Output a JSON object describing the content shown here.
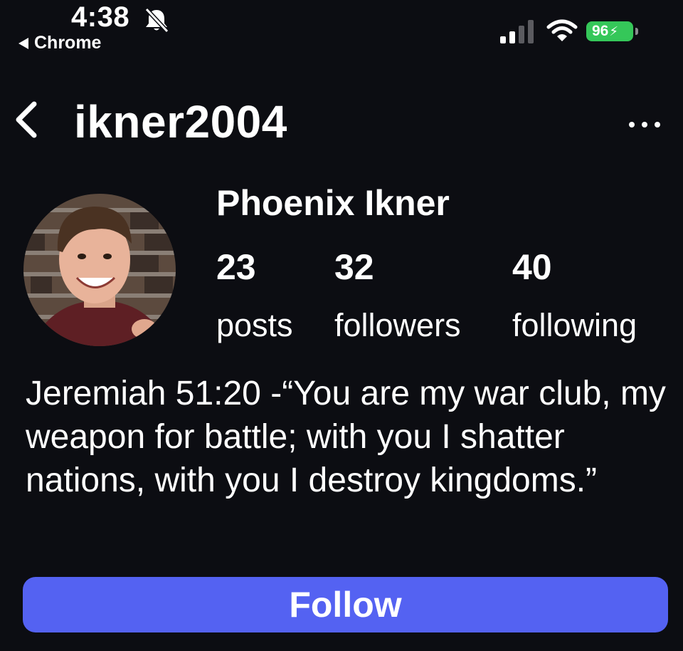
{
  "status_bar": {
    "time": "4:38",
    "back_app_label": "Chrome",
    "battery_percent": "96",
    "battery_color": "#35c759",
    "icons": [
      "bell-slash-icon",
      "cellular-signal-icon",
      "wifi-icon",
      "battery-charging-icon"
    ]
  },
  "header": {
    "username": "ikner2004",
    "back_icon": "chevron-left-icon",
    "more_icon": "ellipsis-icon"
  },
  "profile": {
    "display_name": "Phoenix Ikner",
    "stats": [
      {
        "count": "23",
        "label": "posts"
      },
      {
        "count": "32",
        "label": "followers"
      },
      {
        "count": "40",
        "label": "following"
      }
    ],
    "bio": "Jeremiah 51:20 -“You are my war club, my weapon for battle; with you I shatter nations, with you I destroy kingdoms.”"
  },
  "actions": {
    "follow_label": "Follow",
    "follow_color": "#5462f2"
  }
}
